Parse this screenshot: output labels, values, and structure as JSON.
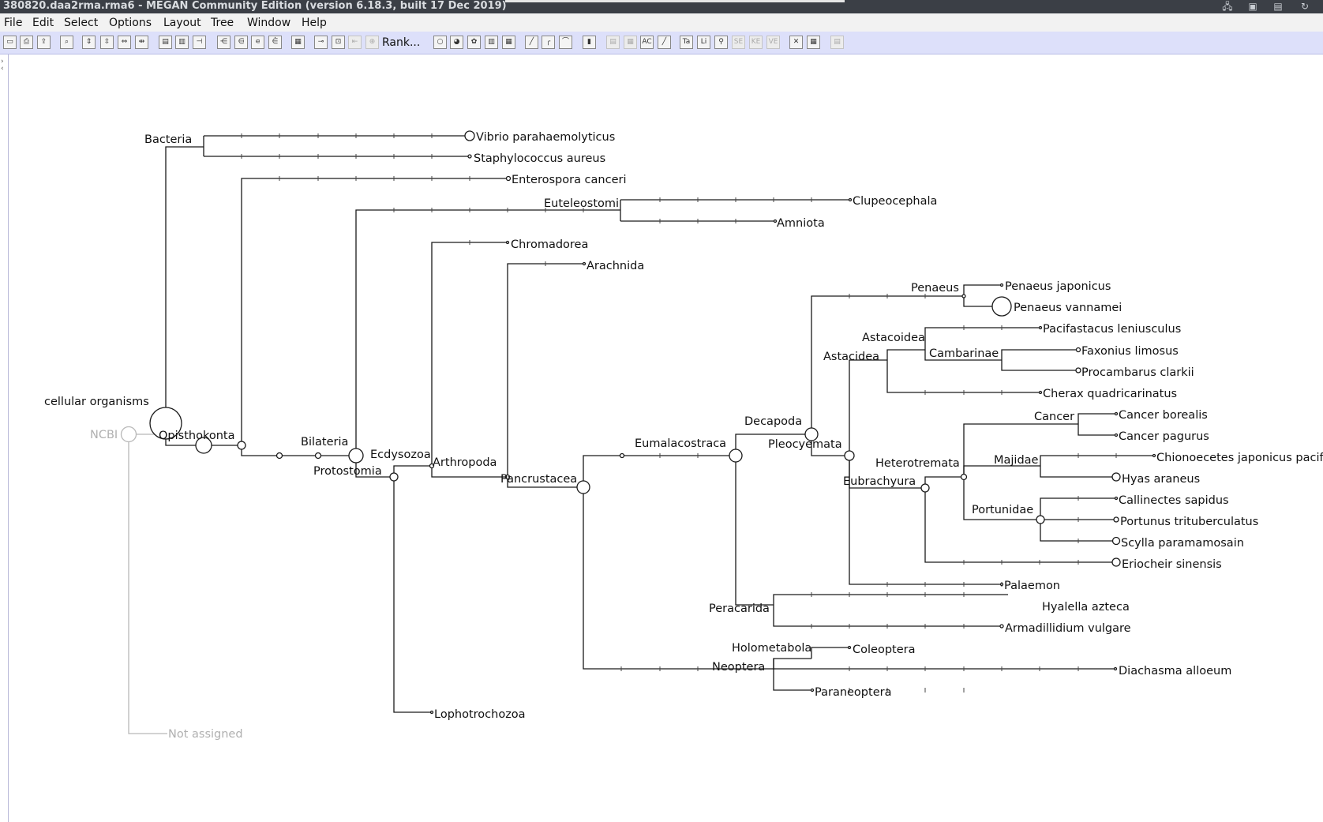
{
  "window": {
    "title": "380820.daa2rma.rma6 - MEGAN Community Edition (version 6.18.3, built 17 Dec 2019)"
  },
  "menu": {
    "file": "File",
    "edit": "Edit",
    "select": "Select",
    "options": "Options",
    "layout": "Layout",
    "tree": "Tree",
    "window": "Window",
    "help": "Help"
  },
  "toolbar": {
    "rank_label": "Rank..."
  },
  "taxonomy_tree": {
    "root": "NCBI",
    "not_assigned": "Not assigned",
    "cellular_organisms": "cellular organisms",
    "bacteria": "Bacteria",
    "vibrio": "Vibrio parahaemolyticus",
    "staphylococcus": "Staphylococcus aureus",
    "opisthokonta": "Opisthokonta",
    "enterospora": "Enterospora canceri",
    "bilateria": "Bilateria",
    "euteleostomi": "Euteleostomi",
    "clupeocephala": "Clupeocephala",
    "amniota": "Amniota",
    "protostomia": "Protostomia",
    "ecdysozoa": "Ecdysozoa",
    "chromadorea": "Chromadorea",
    "arthropoda": "Arthropoda",
    "arachnida": "Arachnida",
    "pancrustacea": "Pancrustacea",
    "lophotrochozoa": "Lophotrochozoa",
    "eumalacostraca": "Eumalacostraca",
    "decapoda": "Decapoda",
    "pleocyemata": "Pleocyemata",
    "penaeus": "Penaeus",
    "penaeus_japonicus": "Penaeus japonicus",
    "penaeus_vannamei": "Penaeus vannamei",
    "astacidea": "Astacidea",
    "astacoidea": "Astacoidea",
    "pacifastacus": "Pacifastacus leniusculus",
    "cambarinae": "Cambarinae",
    "faxonius": "Faxonius limosus",
    "procambarus": "Procambarus clarkii",
    "cherax": "Cherax quadricarinatus",
    "eubrachyura": "Eubrachyura",
    "heterotremata": "Heterotremata",
    "cancer": "Cancer",
    "cancer_borealis": "Cancer borealis",
    "cancer_pagurus": "Cancer pagurus",
    "majidae": "Majidae",
    "chionoecetes": "Chionoecetes japonicus pacifi",
    "hyas": "Hyas araneus",
    "portunidae": "Portunidae",
    "callinectes": "Callinectes sapidus",
    "portunus": "Portunus trituberculatus",
    "scylla": "Scylla paramamosain",
    "eriocheir": "Eriocheir sinensis",
    "palaemon": "Palaemon",
    "peracarida": "Peracarida",
    "hyalella": "Hyalella azteca",
    "armadillidium": "Armadillidium vulgare",
    "neoptera": "Neoptera",
    "holometabola": "Holometabola",
    "coleoptera": "Coleoptera",
    "diachasma": "Diachasma alloeum",
    "paraneoptera": "Paraneoptera"
  }
}
